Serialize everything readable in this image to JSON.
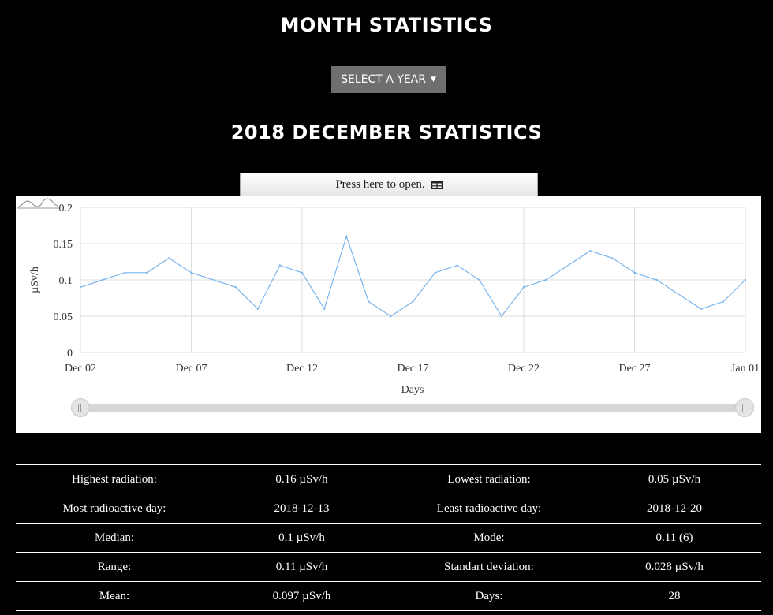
{
  "header": {
    "title": "MONTH STATISTICS",
    "year_button": "SELECT A YEAR",
    "subtitle": "2018 DECEMBER STATISTICS",
    "open_button": "Press here to open."
  },
  "icons": {
    "caret": "caret-down-icon",
    "table": "table-icon",
    "reset_zoom": "reset-zoom-icon"
  },
  "chart_data": {
    "type": "line",
    "xlabel": "Days",
    "ylabel": "µSv/h",
    "ylim": [
      0,
      0.2
    ],
    "yticks": [
      "0",
      "0.05",
      "0.1",
      "0.15",
      "0.2"
    ],
    "xticks": [
      "Dec 02",
      "Dec 07",
      "Dec 12",
      "Dec 17",
      "Dec 22",
      "Dec 27",
      "Jan 01"
    ],
    "x_range": [
      "2018-12-02",
      "2019-01-01"
    ],
    "grid": true,
    "line_color": "#7cb5ec",
    "series": [
      {
        "x": [
          "2018-12-02",
          "2018-12-03",
          "2018-12-04",
          "2018-12-05",
          "2018-12-06",
          "2018-12-07",
          "2018-12-09",
          "2018-12-10",
          "2018-12-11",
          "2018-12-12",
          "2018-12-13",
          "2018-12-14",
          "2018-12-15",
          "2018-12-16",
          "2018-12-17",
          "2018-12-18",
          "2018-12-19",
          "2018-12-20",
          "2018-12-21",
          "2018-12-22",
          "2018-12-23",
          "2018-12-25",
          "2018-12-26",
          "2018-12-27",
          "2018-12-28",
          "2018-12-30",
          "2018-12-31",
          "2019-01-01"
        ],
        "values": [
          0.09,
          0.1,
          0.11,
          0.11,
          0.13,
          0.11,
          0.09,
          0.06,
          0.12,
          0.11,
          0.06,
          0.16,
          0.07,
          0.05,
          0.07,
          0.11,
          0.12,
          0.1,
          0.05,
          0.09,
          0.1,
          0.14,
          0.13,
          0.11,
          0.1,
          0.06,
          0.07,
          0.1
        ]
      }
    ]
  },
  "stats": [
    {
      "label1": "Highest radiation:",
      "value1": "0.16 µSv/h",
      "label2": "Lowest radiation:",
      "value2": "0.05 µSv/h"
    },
    {
      "label1": "Most radioactive day:",
      "value1": "2018-12-13",
      "label2": "Least radioactive day:",
      "value2": "2018-12-20"
    },
    {
      "label1": "Median:",
      "value1": "0.1 µSv/h",
      "label2": "Mode:",
      "value2": "0.11 (6)"
    },
    {
      "label1": "Range:",
      "value1": "0.11 µSv/h",
      "label2": "Standart deviation:",
      "value2": "0.028 µSv/h"
    },
    {
      "label1": "Mean:",
      "value1": "0.097 µSv/h",
      "label2": "Days:",
      "value2": "28"
    }
  ]
}
